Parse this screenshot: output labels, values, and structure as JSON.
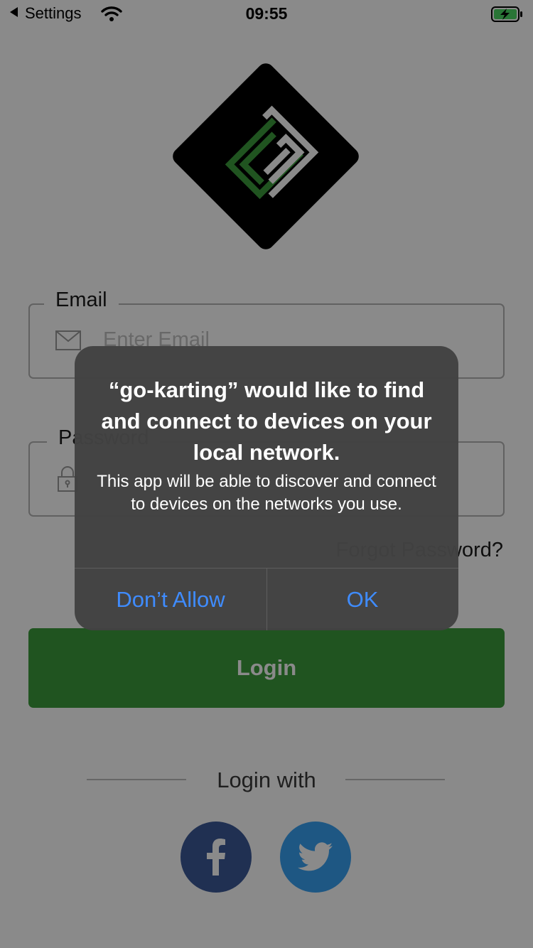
{
  "status_bar": {
    "back_label": "Settings",
    "time": "09:55"
  },
  "form": {
    "email_label": "Email",
    "email_placeholder": "Enter Email",
    "password_label": "Password",
    "forgot_password": "Forgot Password?",
    "login_button": "Login",
    "login_with": "Login with"
  },
  "social": [
    "facebook-icon",
    "twitter-icon"
  ],
  "alert": {
    "title": "“go-karting” would like to find and connect to devices on your local network.",
    "message": "This app will be able to discover and connect to devices on the networks you use.",
    "deny_button": "Don’t Allow",
    "ok_button": "OK"
  },
  "colors": {
    "brand_green": "#3b9c3c",
    "facebook": "#3b5998",
    "twitter": "#38a1f3",
    "alert_button": "#3f8cff"
  }
}
